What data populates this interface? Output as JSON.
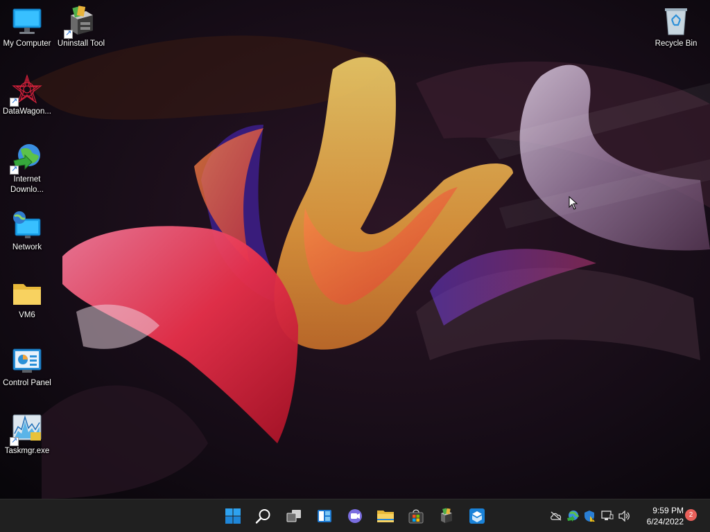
{
  "desktop": {
    "icons": [
      {
        "label": "My Computer",
        "icon": "monitor-icon"
      },
      {
        "label": "Uninstall Tool",
        "icon": "uninstall-tool-icon"
      },
      {
        "label": "DataWagon...",
        "icon": "datawagon-icon"
      },
      {
        "label": "Internet Downlo...",
        "icon": "internet-download-manager-icon"
      },
      {
        "label": "Network",
        "icon": "network-icon"
      },
      {
        "label": "VM6",
        "icon": "folder-icon"
      },
      {
        "label": "Control Panel",
        "icon": "control-panel-icon"
      },
      {
        "label": "Taskmgr.exe",
        "icon": "task-manager-icon"
      },
      {
        "label": "Recycle Bin",
        "icon": "recycle-bin-icon"
      }
    ]
  },
  "taskbar": {
    "pinned": [
      {
        "name": "start",
        "icon": "windows-start-icon"
      },
      {
        "name": "search",
        "icon": "search-icon"
      },
      {
        "name": "task-view",
        "icon": "task-view-icon"
      },
      {
        "name": "widgets",
        "icon": "widgets-icon"
      },
      {
        "name": "chat",
        "icon": "teams-chat-icon"
      },
      {
        "name": "file-explorer",
        "icon": "folder-icon"
      },
      {
        "name": "store",
        "icon": "store-icon"
      },
      {
        "name": "app",
        "icon": "tools-icon"
      },
      {
        "name": "app2",
        "icon": "box-icon"
      }
    ],
    "tray": [
      "cloud-offline-icon",
      "network-globe-icon",
      "security-shield-icon",
      "ethernet-icon",
      "volume-icon"
    ],
    "clock": {
      "time": "9:59 PM",
      "date": "6/24/2022"
    },
    "notification_count": "2"
  },
  "colors": {
    "taskbar": "#202020",
    "accent": "#0078d4",
    "badge": "#e8605a"
  }
}
